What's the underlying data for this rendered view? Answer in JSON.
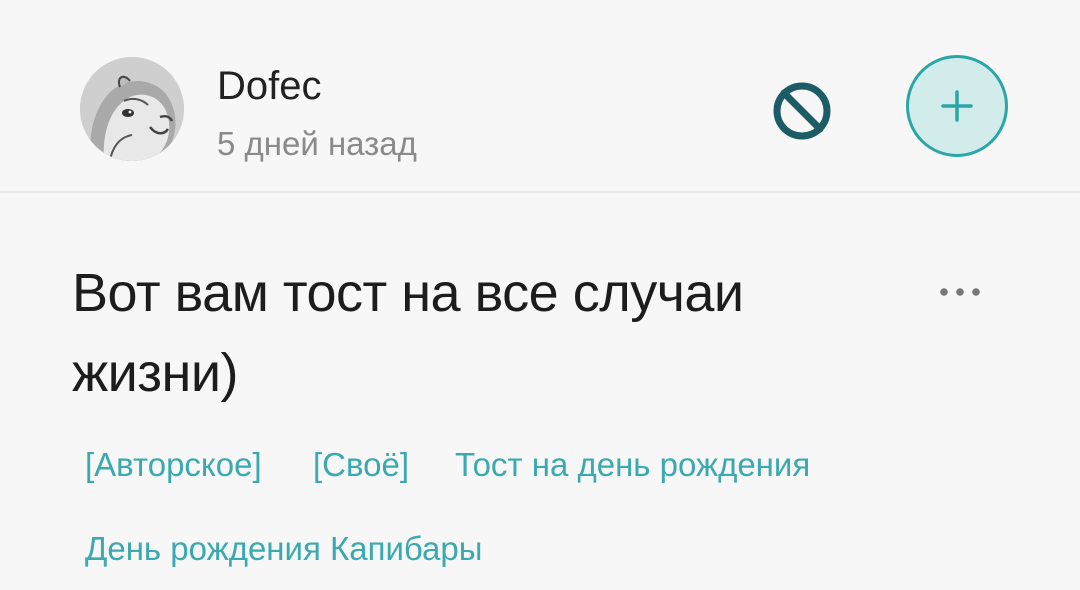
{
  "author": {
    "name": "Dofec",
    "avatar_icon": "capybara-avatar-icon",
    "posted_ago": "5 дней назад"
  },
  "actions": {
    "block_icon": "block-icon",
    "follow_icon": "plus-icon",
    "more_icon": "more-dots-icon"
  },
  "post": {
    "title": "Вот вам тост на все случаи жизни)",
    "tags": [
      "[Авторское]",
      "[Своё]",
      "Тост на день рождения",
      "День рождения Капибары"
    ]
  },
  "colors": {
    "accent": "#2aa6a6",
    "accent_fill": "#d2ecec",
    "block_icon": "#1b5c66",
    "tag_text": "#3aa9b0"
  }
}
